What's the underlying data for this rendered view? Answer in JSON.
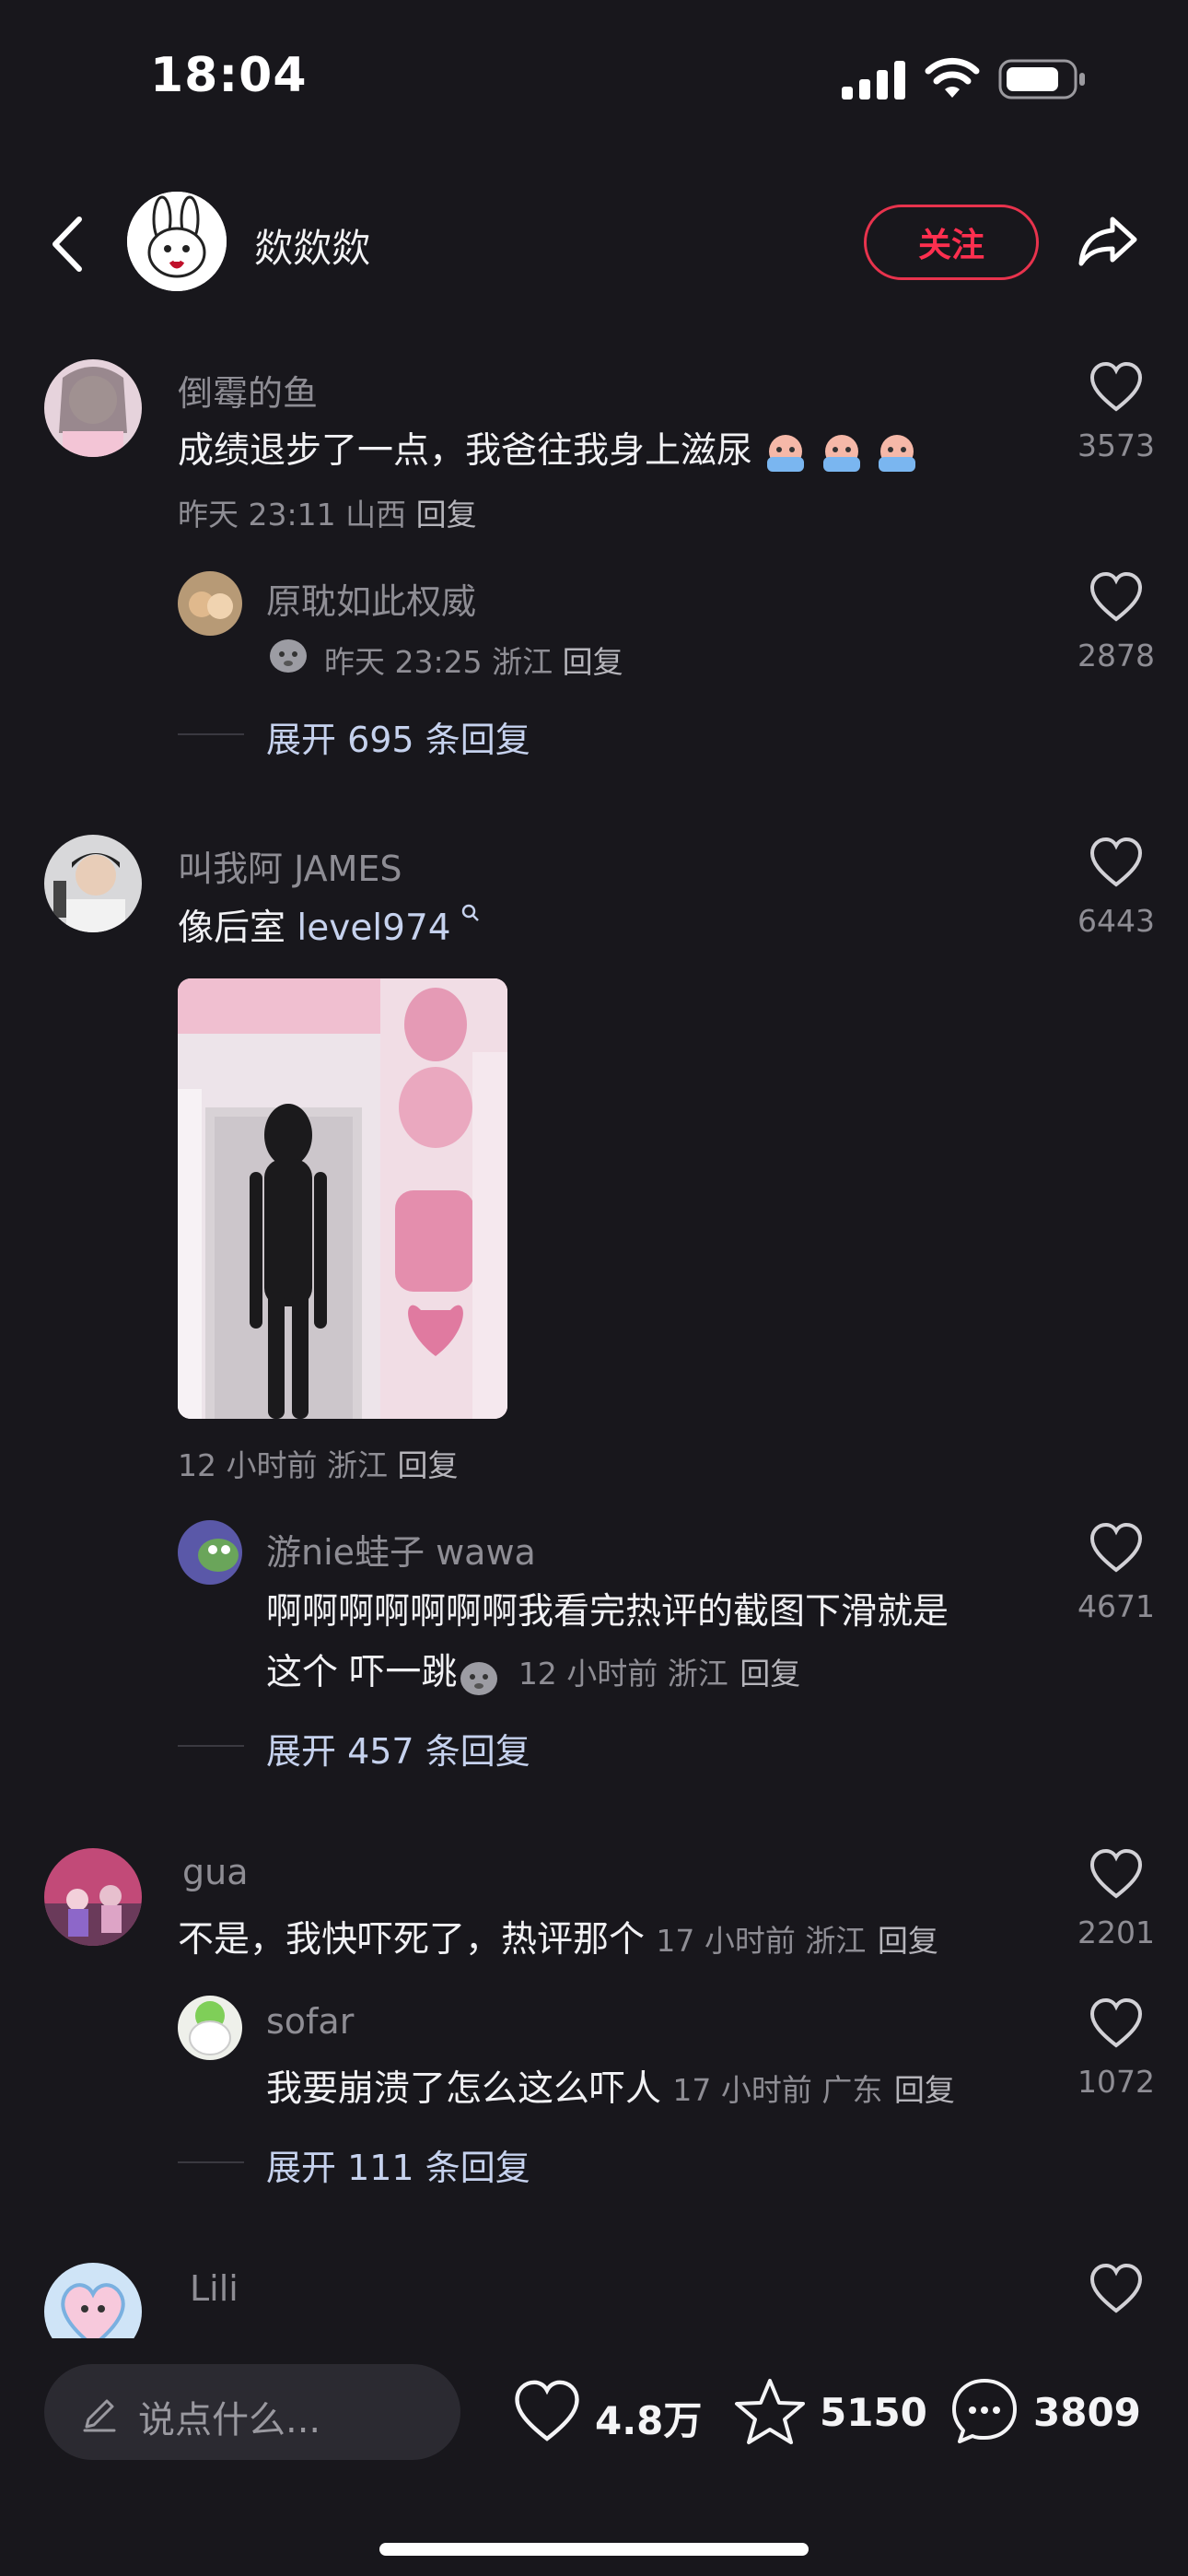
{
  "status_bar": {
    "time": "18:04"
  },
  "header": {
    "author_name": "欻欻欻",
    "follow_label": "关注"
  },
  "comments": [
    {
      "username": "倒霉的鱼",
      "text": "成绩退步了一点，我爸往我身上滋尿",
      "meta": "昨天 23:11 山西",
      "reply_label": "回复",
      "likes": "3573",
      "reply": {
        "username": "原耽如此权威",
        "meta": "昨天 23:25 浙江",
        "reply_label": "回复",
        "likes": "2878"
      },
      "expand": "展开 695 条回复"
    },
    {
      "username": "叫我阿 JAMES",
      "text_prefix": "像后室 ",
      "text_link": "level974",
      "meta": "12 小时前 浙江",
      "reply_label": "回复",
      "likes": "6443",
      "reply": {
        "username": "游nie蛙子 wawa",
        "text_line1": "啊啊啊啊啊啊啊我看完热评的截图下滑就是",
        "text_line2": "这个 吓一跳",
        "meta": "12 小时前 浙江",
        "reply_label": "回复",
        "likes": "4671"
      },
      "expand": "展开 457 条回复"
    },
    {
      "username": "gua",
      "text": "不是，我快吓死了，热评那个",
      "meta": "17 小时前 浙江",
      "reply_label": "回复",
      "likes": "2201",
      "reply": {
        "username": "sofar",
        "text": "我要崩溃了怎么这么吓人",
        "meta": "17 小时前 广东",
        "reply_label": "回复",
        "likes": "1072"
      },
      "expand": "展开 111 条回复"
    },
    {
      "username": "Lili"
    }
  ],
  "bottom_bar": {
    "input_placeholder": "说点什么...",
    "like_count": "4.8万",
    "favorite_count": "5150",
    "comment_count": "3809"
  },
  "colors": {
    "background": "#18171c",
    "follow": "#ff2f4f",
    "expand_link": "#c6d2ee"
  }
}
